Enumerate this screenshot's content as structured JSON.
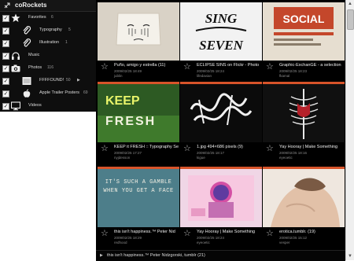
{
  "app": {
    "title": "coRockets"
  },
  "sidebar": {
    "items": [
      {
        "label": "Favorites",
        "count": "6",
        "icon": "star-icon",
        "checked": true,
        "level": 1
      },
      {
        "label": "Typography",
        "count": "5",
        "icon": "paperclip-icon",
        "checked": true,
        "level": 2
      },
      {
        "label": "Illustration",
        "count": "1",
        "icon": "paperclip-icon",
        "checked": true,
        "level": 2
      },
      {
        "label": "Music",
        "count": "",
        "icon": "headphones-icon",
        "checked": true,
        "level": 1
      },
      {
        "label": "Photos",
        "count": "116",
        "icon": "camera-icon",
        "checked": true,
        "level": 1
      },
      {
        "label": "FFFFOUND!",
        "count": "50",
        "icon": "ffffound-icon",
        "checked": true,
        "level": 2,
        "expandable": true
      },
      {
        "label": "Apple Trailer Posters",
        "count": "69",
        "icon": "apple-icon",
        "checked": true,
        "level": 2
      },
      {
        "label": "Videos",
        "count": "",
        "icon": "monitor-icon",
        "checked": true,
        "level": 1
      }
    ]
  },
  "gallery": {
    "tiles": [
      {
        "title": "Puño, amigo y estrella (11)",
        "date": "2009/02/25 18:49",
        "user": "jublin"
      },
      {
        "title": "ECLIPSE SINS on Flickr - Photo",
        "date": "2009/02/25 18:24",
        "user": "lifedavian"
      },
      {
        "title": "Graphic-ExchanGE - a selection",
        "date": "2009/02/25 18:23",
        "user": "fkamal"
      },
      {
        "title": "KEEP it FRESH :: Typography Se",
        "date": "2009/02/25 17:27",
        "user": "nyjdesson"
      },
      {
        "title": "1.jpg 494×686 pixels (9)",
        "date": "2009/02/25 18:17",
        "user": "kigue"
      },
      {
        "title": "Yay Hooray | Make Something",
        "date": "2009/02/25 18:16",
        "user": "eyeoetic"
      },
      {
        "title": "this isn't happiness.™ Peter Nid",
        "date": "2009/02/25 18:29",
        "user": "redhood"
      },
      {
        "title": "Yay Hooray | Make Something",
        "date": "2009/02/25 18:24",
        "user": "eyeoetic"
      },
      {
        "title": "erotica.tumblr. (19)",
        "date": "2009/02/25 15:12",
        "user": "vesper"
      }
    ]
  },
  "status_bar": {
    "text": "this isn't happiness.™ Peter Nidzgorski, tumblr (21)"
  },
  "thumb_art": {
    "keep": "KEEP",
    "fresh": "FRESH",
    "sing": "SING",
    "seven": "SEVEN",
    "social": "SOCIAL",
    "gamble": "IT'S SUCH A GAMBLE WHEN YOU GET A FACE"
  },
  "colors": {
    "accent": "#d8542a",
    "sidebar_bg": "#0e0e0e",
    "gallery_bg": "#000000"
  }
}
